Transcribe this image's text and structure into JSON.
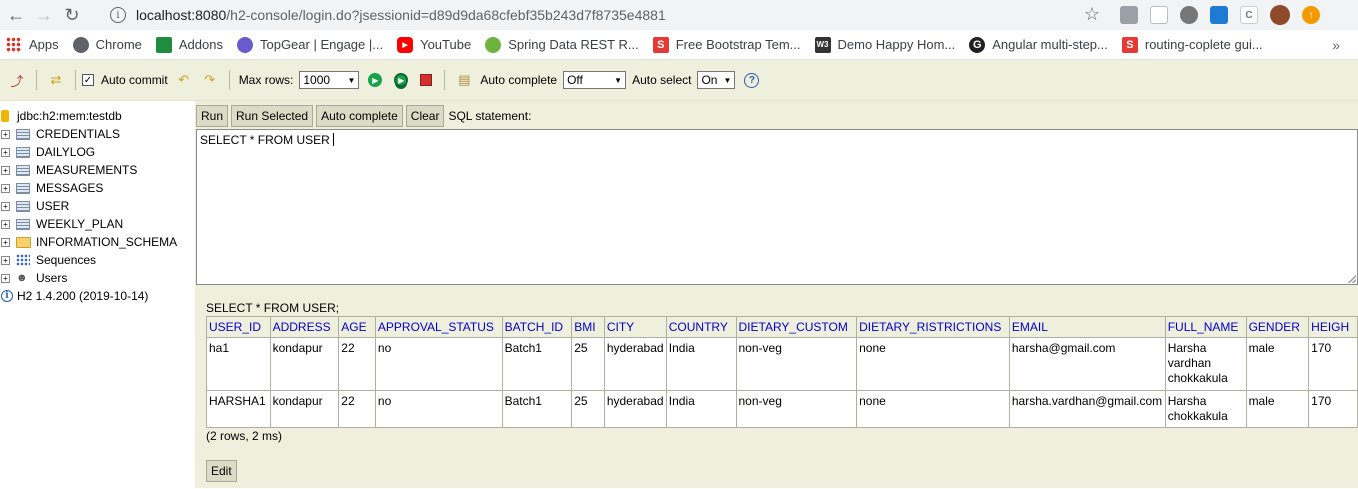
{
  "browser": {
    "url_host": "localhost:8080",
    "url_path": "/h2-console/login.do?jsessionid=d89d9da68cfebf35b243d7f8735e4881"
  },
  "bookmarks": [
    {
      "label": "Apps",
      "icon": "apps-grid-icon",
      "color": "#d93025"
    },
    {
      "label": "Chrome",
      "icon": "chrome-icon",
      "color": "#5f6368"
    },
    {
      "label": "Addons",
      "icon": "puzzle-icon",
      "color": "#1e8e3e"
    },
    {
      "label": "TopGear | Engage |...",
      "icon": "topgear-icon",
      "color": "#6a5acd"
    },
    {
      "label": "YouTube",
      "icon": "youtube-icon",
      "color": "#ff0000"
    },
    {
      "label": "Spring Data REST R...",
      "icon": "spring-icon",
      "color": "#6db33f"
    },
    {
      "label": "Free Bootstrap Tem...",
      "icon": "s-icon",
      "color": "#e53935"
    },
    {
      "label": "Demo Happy Hom...",
      "icon": "w3-icon",
      "color": "#333333"
    },
    {
      "label": "Angular multi-step...",
      "icon": "g-icon",
      "color": "#202124"
    },
    {
      "label": "routing-coplete gui...",
      "icon": "scribd-icon",
      "color": "#e53935"
    }
  ],
  "toolbar": {
    "auto_commit": "Auto commit",
    "max_rows_label": "Max rows:",
    "max_rows_value": "1000",
    "auto_complete_label": "Auto complete",
    "auto_complete_value": "Off",
    "auto_select_label": "Auto select",
    "auto_select_value": "On",
    "help": "?"
  },
  "tree": {
    "connection": "jdbc:h2:mem:testdb",
    "tables": [
      "CREDENTIALS",
      "DAILYLOG",
      "MEASUREMENTS",
      "MESSAGES",
      "USER",
      "WEEKLY_PLAN"
    ],
    "schema": "INFORMATION_SCHEMA",
    "sequences": "Sequences",
    "users": "Users",
    "version": "H2 1.4.200 (2019-10-14)"
  },
  "query": {
    "run": "Run",
    "run_selected": "Run Selected",
    "auto_complete": "Auto complete",
    "clear": "Clear",
    "sql_label": "SQL statement:",
    "sql_text": "SELECT * FROM USER"
  },
  "result": {
    "title": "SELECT * FROM USER;",
    "columns": [
      "USER_ID",
      "ADDRESS",
      "AGE",
      "APPROVAL_STATUS",
      "BATCH_ID",
      "BMI",
      "CITY",
      "COUNTRY",
      "DIETARY_CUSTOM",
      "DIETARY_RISTRICTIONS",
      "EMAIL",
      "FULL_NAME",
      "GENDER",
      "HEIGH"
    ],
    "rows": [
      [
        "ha1",
        "kondapur",
        "22",
        "no",
        "Batch1",
        "25",
        "hyderabad",
        "India",
        "non-veg",
        "none",
        "harsha@gmail.com",
        "Harsha vardhan chokkakula",
        "male",
        "170"
      ],
      [
        "HARSHA1",
        "kondapur",
        "22",
        "no",
        "Batch1",
        "25",
        "hyderabad",
        "India",
        "non-veg",
        "none",
        "harsha.vardhan@gmail.com",
        "Harsha chokkakula",
        "male",
        "170"
      ]
    ],
    "footer": "(2 rows, 2 ms)",
    "edit": "Edit"
  }
}
